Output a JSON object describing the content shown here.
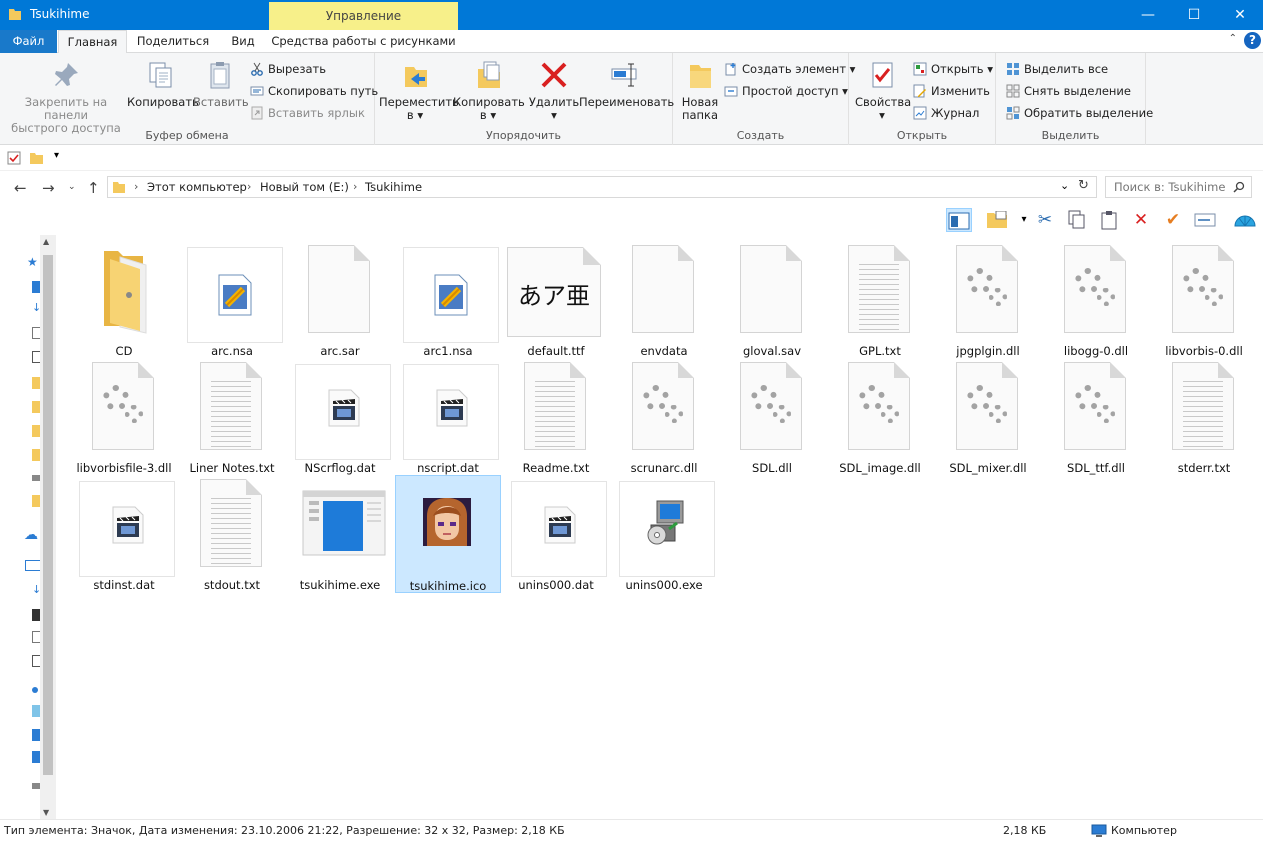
{
  "window": {
    "title": "Tsukihime",
    "context_tab_header": "Управление",
    "minimize_glyph": "—",
    "maximize_glyph": "☐",
    "close_glyph": "✕"
  },
  "tabs": {
    "file": "Файл",
    "home": "Главная",
    "share": "Поделиться",
    "view": "Вид",
    "picture_tools": "Средства работы с рисунками"
  },
  "ribbon": {
    "clipboard": {
      "label": "Буфер обмена",
      "pin_line1": "Закрепить на панели",
      "pin_line2": "быстрого доступа",
      "copy": "Копировать",
      "paste": "Вставить",
      "cut": "Вырезать",
      "copy_path": "Скопировать путь",
      "paste_shortcut": "Вставить ярлык"
    },
    "organize": {
      "label": "Упорядочить",
      "move_line1": "Переместить",
      "move_line2": "в",
      "copyto_line1": "Копировать",
      "copyto_line2": "в",
      "delete": "Удалить",
      "rename": "Переименовать"
    },
    "new": {
      "label": "Создать",
      "folder_line1": "Новая",
      "folder_line2": "папка",
      "new_item": "Создать элемент",
      "easy_access": "Простой доступ"
    },
    "open": {
      "label": "Открыть",
      "properties": "Свойства",
      "open": "Открыть",
      "edit": "Изменить",
      "history": "Журнал"
    },
    "select": {
      "label": "Выделить",
      "select_all": "Выделить все",
      "select_none": "Снять выделение",
      "invert": "Обратить выделение"
    }
  },
  "address": {
    "crumbs": [
      "Этот компьютер",
      "Новый том (E:)",
      "Tsukihime"
    ],
    "search_placeholder": "Поиск в: Tsukihime"
  },
  "files": [
    {
      "name": "CD",
      "kind": "folder"
    },
    {
      "name": "arc.nsa",
      "kind": "nsa"
    },
    {
      "name": "arc.sar",
      "kind": "blank"
    },
    {
      "name": "arc1.nsa",
      "kind": "nsa"
    },
    {
      "name": "default.ttf",
      "kind": "font",
      "preview": "あア亜"
    },
    {
      "name": "envdata",
      "kind": "blank"
    },
    {
      "name": "gloval.sav",
      "kind": "blank"
    },
    {
      "name": "GPL.txt",
      "kind": "text"
    },
    {
      "name": "jpgplgin.dll",
      "kind": "dll"
    },
    {
      "name": "libogg-0.dll",
      "kind": "dll"
    },
    {
      "name": "libvorbis-0.dll",
      "kind": "dll"
    },
    {
      "name": "libvorbisfile-3.dll",
      "kind": "dll"
    },
    {
      "name": "Liner Notes.txt",
      "kind": "text"
    },
    {
      "name": "NScrflog.dat",
      "kind": "media"
    },
    {
      "name": "nscript.dat",
      "kind": "media"
    },
    {
      "name": "Readme.txt",
      "kind": "text"
    },
    {
      "name": "scrunarc.dll",
      "kind": "dll"
    },
    {
      "name": "SDL.dll",
      "kind": "dll"
    },
    {
      "name": "SDL_image.dll",
      "kind": "dll"
    },
    {
      "name": "SDL_mixer.dll",
      "kind": "dll"
    },
    {
      "name": "SDL_ttf.dll",
      "kind": "dll"
    },
    {
      "name": "stderr.txt",
      "kind": "text"
    },
    {
      "name": "stdinst.dat",
      "kind": "media"
    },
    {
      "name": "stdout.txt",
      "kind": "text"
    },
    {
      "name": "tsukihime.exe",
      "kind": "exe"
    },
    {
      "name": "tsukihime.ico",
      "kind": "ico",
      "selected": true
    },
    {
      "name": "unins000.dat",
      "kind": "media"
    },
    {
      "name": "unins000.exe",
      "kind": "installer"
    }
  ],
  "status": {
    "details": "Тип элемента: Значок, Дата изменения: 23.10.2006 21:22, Разрешение: 32 x 32, Размер: 2,18 КБ",
    "size": "2,18 КБ",
    "location": "Компьютер"
  },
  "colors": {
    "titlebar": "#0078d7",
    "context_tab": "#f7f08a",
    "selection": "#cce8ff",
    "folder": "#f4c95d"
  }
}
